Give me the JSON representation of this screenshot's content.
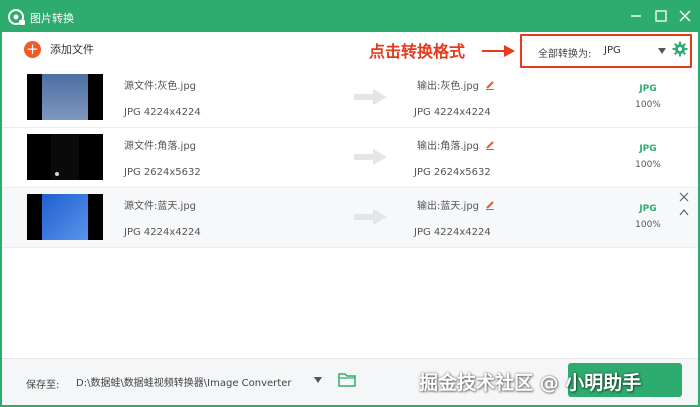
{
  "app": {
    "title": "图片转换",
    "accent_color": "#2eab6e",
    "window_controls": [
      "minimize-icon",
      "maximize-icon",
      "close-icon"
    ]
  },
  "toolbar": {
    "add_label": "添加文件",
    "annotation": "点击转换格式",
    "convert_all_label": "全部转换为:",
    "format": "JPG"
  },
  "files": [
    {
      "source_name": "源文件:灰色.jpg",
      "source_info": "JPG  4224x4224",
      "output_name": "输出:灰色.jpg",
      "output_info": "JPG  4224x4224",
      "format": "JPG",
      "progress": "100%"
    },
    {
      "source_name": "源文件:角落.jpg",
      "source_info": "JPG  2624x5632",
      "output_name": "输出:角落.jpg",
      "output_info": "JPG  2624x5632",
      "format": "JPG",
      "progress": "100%"
    },
    {
      "source_name": "源文件:蓝天.jpg",
      "source_info": "JPG  4224x4224",
      "output_name": "输出:蓝天.jpg",
      "output_info": "JPG  4224x4224",
      "format": "JPG",
      "progress": "100%"
    }
  ],
  "footer": {
    "save_label": "保存至:",
    "save_path": "D:\\数据蛙\\数据蛙视频转换器\\Image Converter",
    "watermark": "掘金技术社区 @ 小明助手"
  }
}
